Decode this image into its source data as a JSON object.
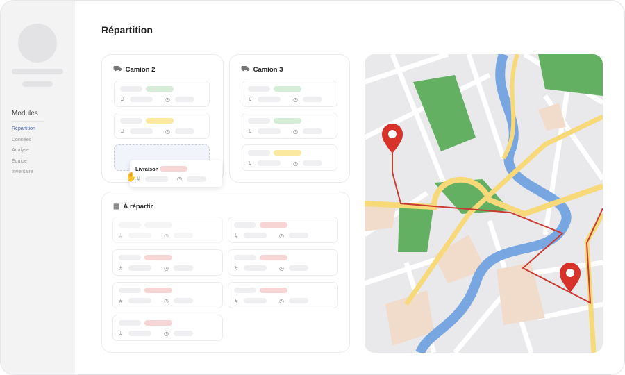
{
  "page_title": "Répartition",
  "sidebar": {
    "section": "Modules",
    "items": [
      {
        "label": "Répartition",
        "active": true
      },
      {
        "label": "Données"
      },
      {
        "label": "Analyse"
      },
      {
        "label": "Équipe"
      },
      {
        "label": "Inventaire"
      }
    ]
  },
  "colors": {
    "green": "#d6edd8",
    "yellow": "#fbe9a0",
    "red": "#f8d5d5",
    "gray": "#efeff1",
    "accent": "#3d5fa8"
  },
  "trucks": [
    {
      "title": "Camion 2",
      "icon": "truck-icon",
      "cards": [
        "green",
        "yellow"
      ]
    },
    {
      "title": "Camion 3",
      "icon": "truck-icon",
      "cards": [
        "green",
        "green",
        "yellow"
      ]
    }
  ],
  "dragged_card": {
    "label": "Livraison",
    "tag": "red"
  },
  "unassigned": {
    "title": "À répartir",
    "icon": "calendar-icon",
    "cards": [
      "gray",
      "red",
      "red",
      "red",
      "red",
      "red",
      "red"
    ]
  }
}
